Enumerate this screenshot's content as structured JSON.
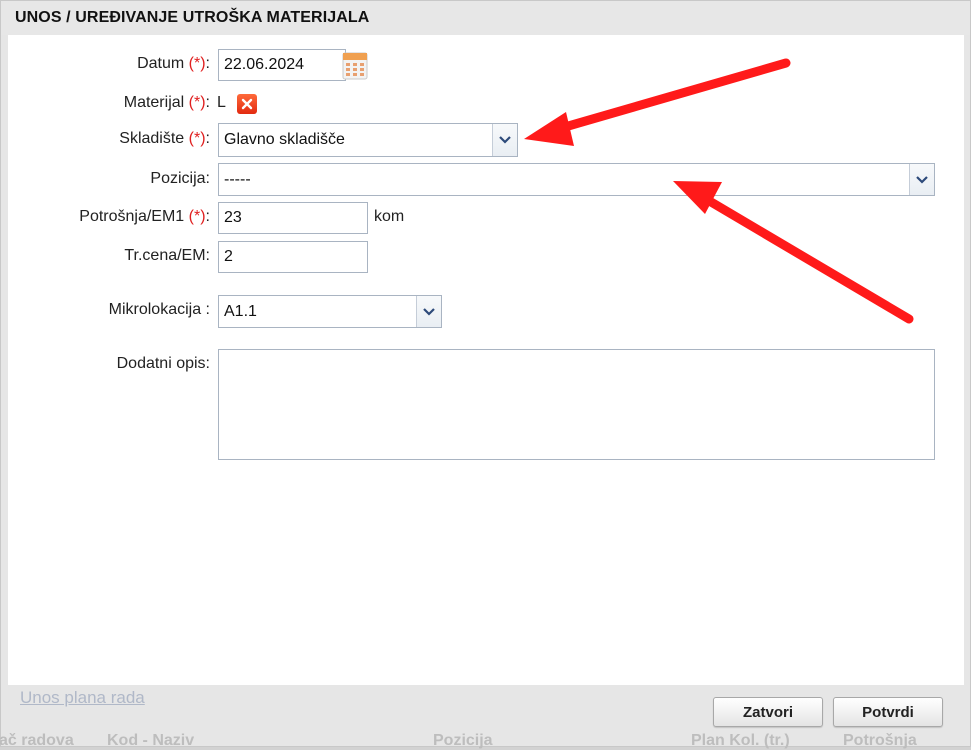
{
  "dialog": {
    "title": "UNOS / UREĐIVANJE UTROŠKA MATERIJALA"
  },
  "form": {
    "required_mark": "(*)",
    "datum": {
      "label": "Datum",
      "colon": ":",
      "value": "22.06.2024"
    },
    "materijal": {
      "label": "Materijal",
      "colon": ":",
      "value": "L"
    },
    "skladiste": {
      "label": "Skladište",
      "colon": ":",
      "value": "Glavno skladišče"
    },
    "pozicija": {
      "label": "Pozicija:",
      "value": "-----"
    },
    "potrosnja": {
      "label": "Potrošnja/EM1",
      "colon": ":",
      "value": "23",
      "unit": "kom"
    },
    "trcena": {
      "label": "Tr.cena/EM:",
      "value": "2"
    },
    "mikrolokacija": {
      "label": "Mikrolokacija :",
      "value": "A1.1"
    },
    "dodatni_opis": {
      "label": "Dodatni opis:",
      "value": ""
    }
  },
  "buttons": {
    "close": "Zatvori",
    "confirm": "Potvrdi"
  },
  "background": {
    "link": "Unos plana rada",
    "columns": [
      "ač radova",
      "Kod - Naziv",
      "Pozicija",
      "Plan Kol. (tr.)",
      "Potrošnja"
    ]
  },
  "annotation_color": "#ff1a1a"
}
